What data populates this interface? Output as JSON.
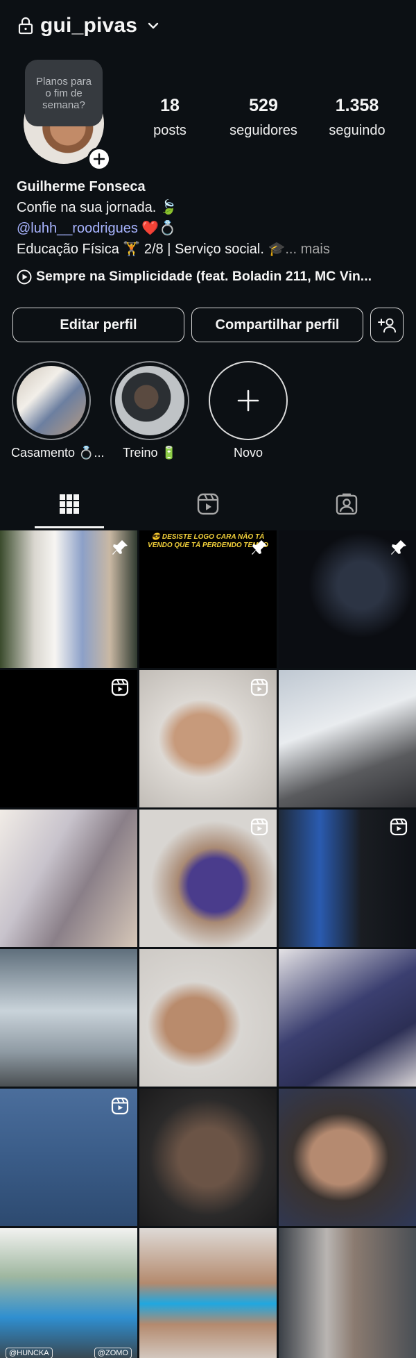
{
  "header": {
    "username": "gui_pivas"
  },
  "profile": {
    "note": "Planos para o fim de semana?",
    "stats": [
      {
        "value": "18",
        "label": "posts"
      },
      {
        "value": "529",
        "label": "seguidores"
      },
      {
        "value": "1.358",
        "label": "seguindo"
      }
    ],
    "name": "Guilherme Fonseca",
    "bio_line1": "Confie na sua jornada. 🍃",
    "bio_mention": "@luhh__roodrigues",
    "bio_mention_emoji": " ❤️💍",
    "bio_line3": "Educação Física 🏋️ 2/8 | Serviço social. 🎓",
    "bio_more": "... mais",
    "music": "Sempre na Simplicidade (feat. Boladin 211, MC Vin..."
  },
  "actions": {
    "edit_profile": "Editar perfil",
    "share_profile": "Compartilhar perfil"
  },
  "highlights": [
    {
      "caption": "Casamento 💍..."
    },
    {
      "caption": "Treino 🔋"
    },
    {
      "caption": "Novo"
    }
  ],
  "tabs": [
    "posts-grid",
    "reels",
    "tagged"
  ],
  "grid": {
    "post2_caption": "😎 DESISTE LOGO CARA NÃO TÁ VENDO QUE TÁ PERDENDO TEMPO",
    "post16_wm1": "@HUNCKA",
    "post16_wm2": "@ZOMO"
  },
  "colors": {
    "background": "#0c1014",
    "mention": "#a8b4ff",
    "muted": "#a8a8a8"
  }
}
